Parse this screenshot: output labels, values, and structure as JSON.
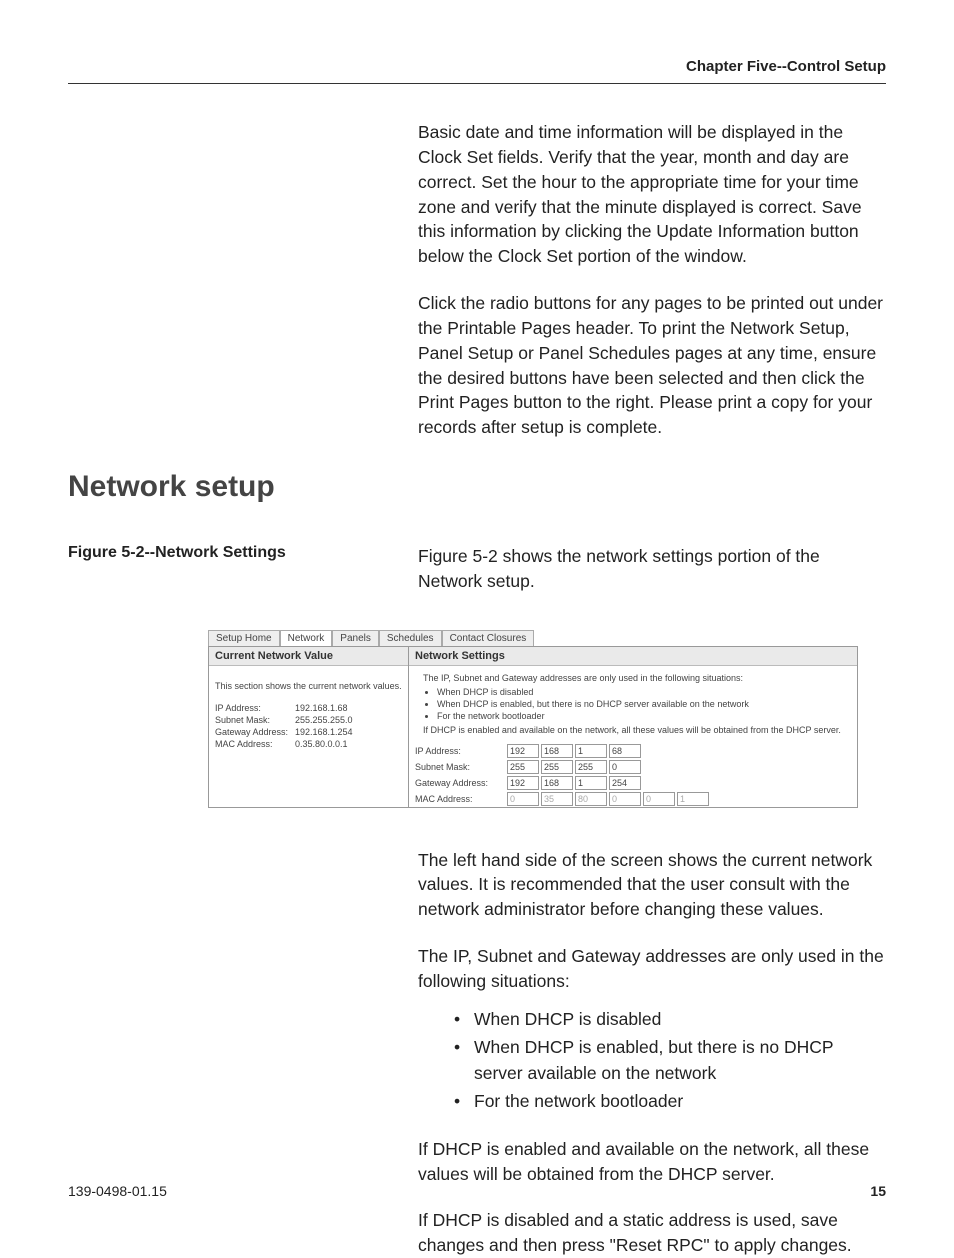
{
  "header": {
    "running": "Chapter Five--Control Setup"
  },
  "intro": {
    "p1": "Basic date and time information will be displayed in the Clock Set fields. Verify that the year, month and day are correct.  Set the hour to the appropriate time for your time zone and verify that the minute displayed is correct. Save this information by clicking the Update Information button below the Clock Set portion of the window.",
    "p2": "Click the radio buttons for any pages to be printed out under the Printable Pages header. To print the Network Setup, Panel Setup or Panel Schedules pages at any time, ensure the desired buttons have been selected and then click the Print Pages button to the right. Please print a copy for your records after setup is complete."
  },
  "section": {
    "title": "Network setup"
  },
  "figure": {
    "label": "Figure 5-2--Network Settings",
    "caption": "Figure 5-2 shows the network settings portion of the Network setup."
  },
  "screenshot": {
    "tabs": [
      "Setup Home",
      "Network",
      "Panels",
      "Schedules",
      "Contact Closures"
    ],
    "left": {
      "title": "Current Network Value",
      "note": "This section shows the current network values.",
      "rows": [
        {
          "label": "IP Address:",
          "value": "192.168.1.68"
        },
        {
          "label": "Subnet Mask:",
          "value": "255.255.255.0"
        },
        {
          "label": "Gateway Address:",
          "value": "192.168.1.254"
        },
        {
          "label": "MAC Address:",
          "value": "0.35.80.0.0.1"
        }
      ]
    },
    "right": {
      "title": "Network Settings",
      "note_lead": "The IP, Subnet and Gateway addresses are only used in the following situations:",
      "note_items": [
        "When DHCP is disabled",
        "When DHCP is enabled, but there is no DHCP server available on the network",
        "For the network bootloader"
      ],
      "note_tail": "If DHCP is enabled and available on the network, all these values will be obtained from the DHCP server.",
      "rows": [
        {
          "label": "IP Address:",
          "octets": [
            "192",
            "168",
            "1",
            "68"
          ]
        },
        {
          "label": "Subnet Mask:",
          "octets": [
            "255",
            "255",
            "255",
            "0"
          ]
        },
        {
          "label": "Gateway Address:",
          "octets": [
            "192",
            "168",
            "1",
            "254"
          ]
        },
        {
          "label": "MAC Address:",
          "octets": [
            "0",
            "35",
            "80",
            "0",
            "0",
            "1"
          ],
          "dim": true
        }
      ]
    }
  },
  "after": {
    "p1": "The left hand side of the screen shows the current network values.   It is recommended that the user consult with the network administrator before changing these values.",
    "p2": "The IP,  Subnet and Gateway addresses are only used in the following situations:",
    "bullets": [
      "When DHCP is disabled",
      "When DHCP is enabled, but there is no DHCP server available on the network",
      "For the network bootloader"
    ],
    "p3": "If DHCP is enabled and available on the network, all these values will be obtained from the DHCP server.",
    "p4": "If DHCP is disabled and a static address is used, save changes and then press \"Reset RPC\" to apply changes."
  },
  "footer": {
    "docnum": "139-0498-01.15",
    "page": "15"
  }
}
